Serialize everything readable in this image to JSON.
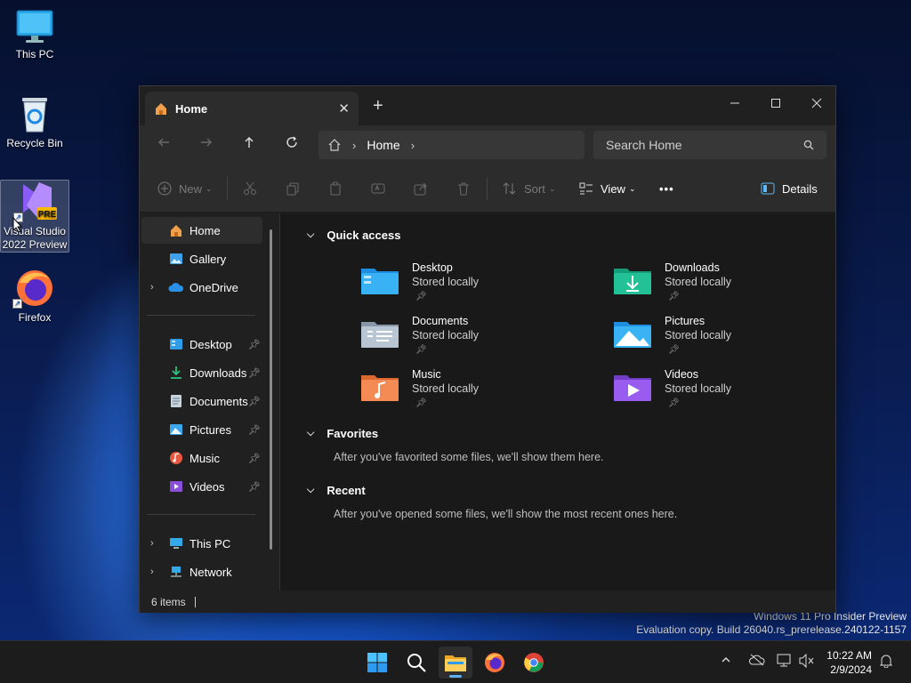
{
  "desktop": {
    "icons": [
      {
        "label": "This PC"
      },
      {
        "label": "Recycle Bin"
      },
      {
        "label": "Visual Studio 2022 Preview",
        "badge": "PRE"
      },
      {
        "label": "Firefox"
      }
    ],
    "watermark": {
      "line1": "Windows 11 Pro Insider Preview",
      "line2": "Evaluation copy. Build 26040.rs_prerelease.240122-1157"
    }
  },
  "explorer": {
    "tab_title": "Home",
    "tab_close": "✕",
    "new_tab": "+",
    "address": {
      "segment": "Home"
    },
    "search": {
      "placeholder": "Search Home"
    },
    "toolbar": {
      "new_label": "New",
      "sort_label": "Sort",
      "view_label": "View",
      "more_label": "•••",
      "details_label": "Details"
    },
    "sidebar": {
      "items": [
        {
          "label": "Home"
        },
        {
          "label": "Gallery"
        },
        {
          "label": "OneDrive"
        },
        {
          "label": "Desktop"
        },
        {
          "label": "Downloads"
        },
        {
          "label": "Documents"
        },
        {
          "label": "Pictures"
        },
        {
          "label": "Music"
        },
        {
          "label": "Videos"
        },
        {
          "label": "This PC"
        },
        {
          "label": "Network"
        }
      ]
    },
    "quick_access": {
      "title": "Quick access",
      "items": [
        {
          "name": "Desktop",
          "status": "Stored locally"
        },
        {
          "name": "Downloads",
          "status": "Stored locally"
        },
        {
          "name": "Documents",
          "status": "Stored locally"
        },
        {
          "name": "Pictures",
          "status": "Stored locally"
        },
        {
          "name": "Music",
          "status": "Stored locally"
        },
        {
          "name": "Videos",
          "status": "Stored locally"
        }
      ]
    },
    "favorites": {
      "title": "Favorites",
      "empty_text": "After you've favorited some files, we'll show them here."
    },
    "recent": {
      "title": "Recent",
      "empty_text": "After you've opened some files, we'll show the most recent ones here."
    },
    "status": {
      "item_count": "6 items"
    }
  },
  "taskbar": {
    "clock": {
      "time": "10:22 AM",
      "date": "2/9/2024"
    }
  },
  "colors": {
    "accent": "#5fb2f2",
    "window_bg": "#202020",
    "content_bg": "#191919"
  }
}
